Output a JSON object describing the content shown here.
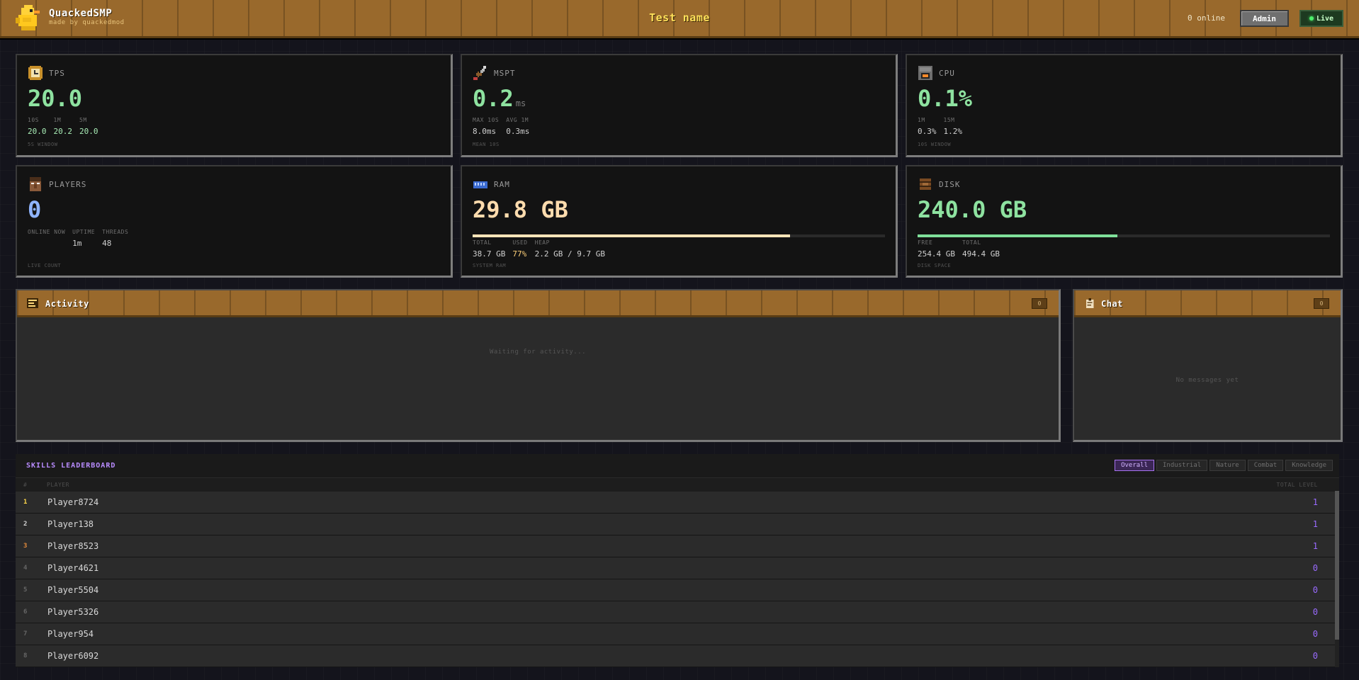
{
  "header": {
    "brand_name": "QuackedSMP",
    "brand_sub": "made by quackedmod",
    "title": "Test name",
    "online": "0 online",
    "admin_label": "Admin",
    "live_label": "Live"
  },
  "stats": {
    "tps": {
      "label": "TPS",
      "icon": "clock-icon",
      "value": "20.0",
      "subs": [
        {
          "label": "10S",
          "value": "20.0"
        },
        {
          "label": "1M",
          "value": "20.2"
        },
        {
          "label": "5M",
          "value": "20.0"
        }
      ],
      "footer": "5S WINDOW"
    },
    "mspt": {
      "label": "MSPT",
      "icon": "sword-icon",
      "value": "0.2",
      "unit": "ms",
      "subs": [
        {
          "label": "MAX 10S",
          "value": "8.0ms"
        },
        {
          "label": "AVG 1M",
          "value": "0.3ms"
        }
      ],
      "footer": "MEAN 10S"
    },
    "cpu": {
      "label": "CPU",
      "icon": "furnace-icon",
      "value": "0.1%",
      "subs": [
        {
          "label": "1M",
          "value": "0.3%"
        },
        {
          "label": "15M",
          "value": "1.2%"
        }
      ],
      "footer": "10S WINDOW"
    },
    "players": {
      "label": "PLAYERS",
      "icon": "villager-icon",
      "value": "0",
      "subs": [
        {
          "label": "ONLINE NOW",
          "value": ""
        },
        {
          "label": "UPTIME",
          "value": "1m"
        },
        {
          "label": "THREADS",
          "value": "48"
        }
      ],
      "footer": "LIVE COUNT"
    },
    "ram": {
      "label": "RAM",
      "icon": "memory-icon",
      "value": "29.8 GB",
      "usage_fraction": 0.77,
      "subs": [
        {
          "label": "TOTAL",
          "value": "38.7 GB"
        },
        {
          "label": "USED",
          "value": "77%"
        },
        {
          "label": "HEAP",
          "value": "2.2 GB / 9.7 GB"
        }
      ],
      "footer": "SYSTEM RAM"
    },
    "disk": {
      "label": "DISK",
      "icon": "barrel-icon",
      "value": "240.0 GB",
      "usage_fraction": 0.485,
      "subs": [
        {
          "label": "FREE",
          "value": "254.4 GB"
        },
        {
          "label": "TOTAL",
          "value": "494.4 GB"
        }
      ],
      "footer": "DISK SPACE"
    }
  },
  "activity": {
    "title": "Activity",
    "count": "0",
    "empty": "Waiting for activity..."
  },
  "chat": {
    "title": "Chat",
    "count": "0",
    "empty": "No messages yet"
  },
  "leaderboard": {
    "title": "SKILLS LEADERBOARD",
    "tabs": [
      "Overall",
      "Industrial",
      "Nature",
      "Combat",
      "Knowledge"
    ],
    "active_tab": "Overall",
    "columns": {
      "rank": "#",
      "player": "PLAYER",
      "level": "TOTAL LEVEL"
    },
    "rows": [
      {
        "rank": "1",
        "player": "Player8724",
        "level": "1"
      },
      {
        "rank": "2",
        "player": "Player138",
        "level": "1"
      },
      {
        "rank": "3",
        "player": "Player8523",
        "level": "1"
      },
      {
        "rank": "4",
        "player": "Player4621",
        "level": "0"
      },
      {
        "rank": "5",
        "player": "Player5504",
        "level": "0"
      },
      {
        "rank": "6",
        "player": "Player5326",
        "level": "0"
      },
      {
        "rank": "7",
        "player": "Player954",
        "level": "0"
      },
      {
        "rank": "8",
        "player": "Player6092",
        "level": "0"
      }
    ]
  },
  "colors": {
    "wood": "#99692c",
    "accent_green": "#8ee2a0",
    "accent_blue": "#8fb4ff",
    "accent_cream": "#ffdcae",
    "accent_purple": "#9a6bff",
    "rank_gold": "#ffd84a",
    "rank_silver": "#d0d0d0",
    "rank_bronze": "#e08a3c"
  }
}
